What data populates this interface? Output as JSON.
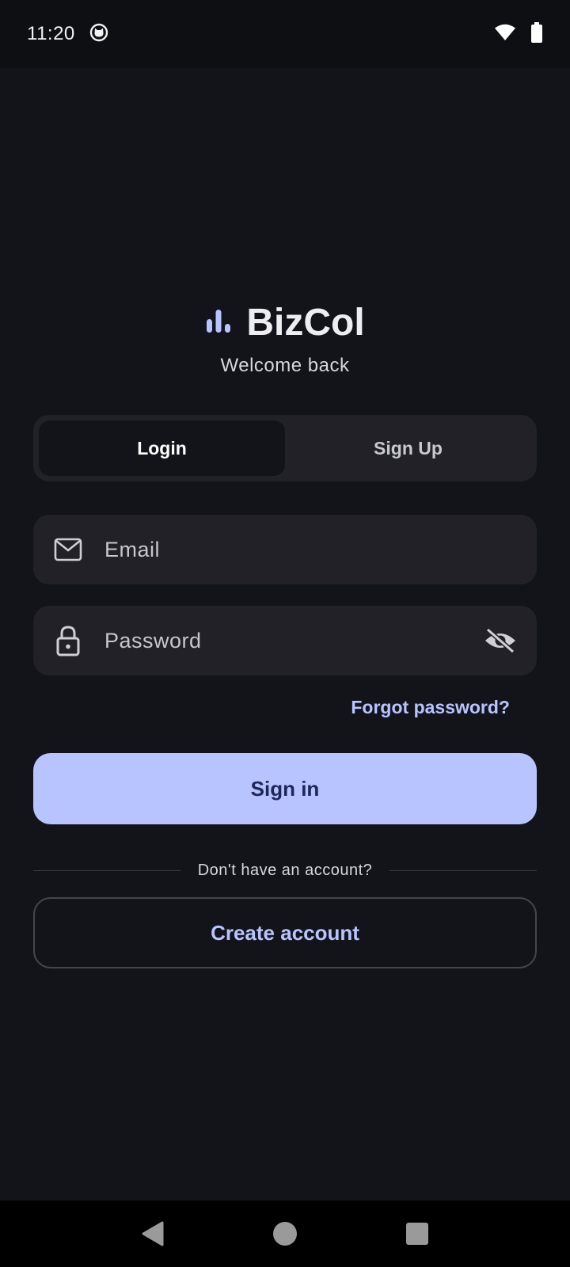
{
  "status_bar": {
    "time": "11:20",
    "icons": [
      "cat-face-icon",
      "wifi-icon",
      "battery-icon"
    ]
  },
  "brand": {
    "name": "BizCol",
    "logo_icon": "bar-chart-icon",
    "subtitle": "Welcome back"
  },
  "tabs": [
    {
      "label": "Login",
      "active": true
    },
    {
      "label": "Sign Up",
      "active": false
    }
  ],
  "form": {
    "email": {
      "placeholder": "Email",
      "value": "",
      "icon": "mail-icon"
    },
    "password": {
      "placeholder": "Password",
      "value": "",
      "icon": "lock-icon",
      "toggle_icon": "eye-off-icon"
    },
    "forgot_label": "Forgot password?",
    "signin_label": "Sign in",
    "divider_text": "Don't have an account?",
    "create_label": "Create account"
  },
  "nav_bar": {
    "icons": [
      "back-triangle-icon",
      "home-circle-icon",
      "recents-square-icon"
    ]
  },
  "colors": {
    "background": "#13141a",
    "surface": "#212127",
    "accent": "#b8c4ff",
    "accent_text": "#1e2757"
  }
}
